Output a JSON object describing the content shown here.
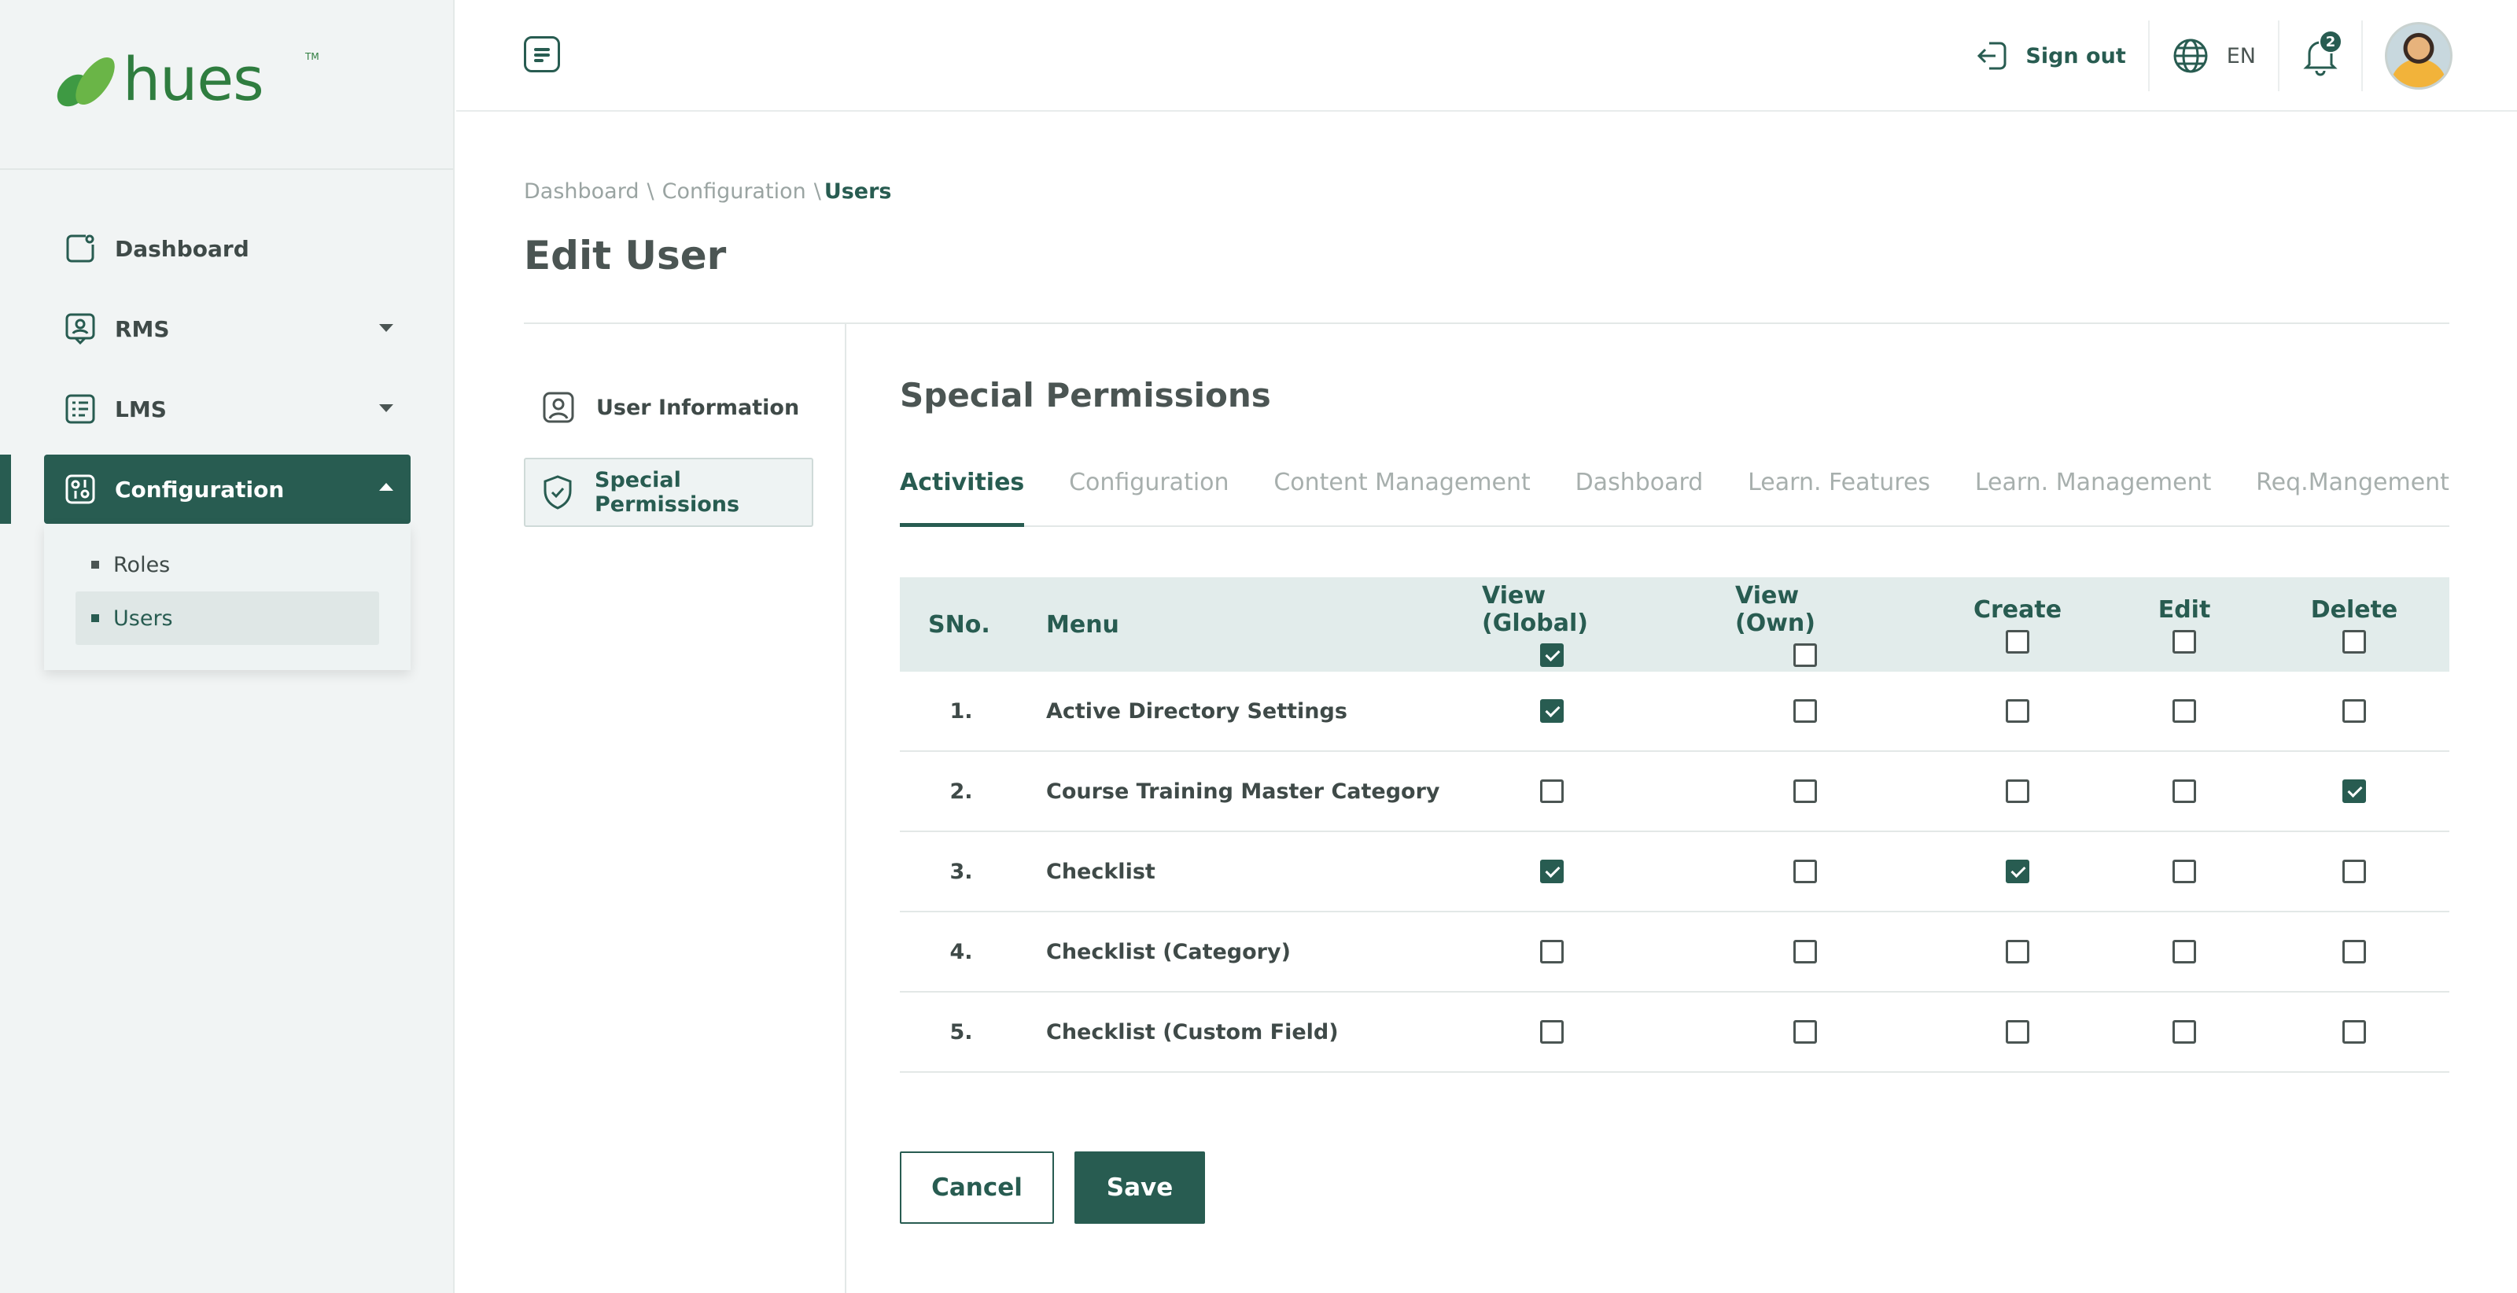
{
  "brand": {
    "name": "hues",
    "tm": "TM"
  },
  "colors": {
    "primary": "#285c51",
    "brand_green": "#2f7d3f",
    "sidebar_bg": "#f1f4f4",
    "table_head_bg": "#e2eceb"
  },
  "sidebar": {
    "items": [
      {
        "label": "Dashboard",
        "icon": "dashboard-icon",
        "expandable": false
      },
      {
        "label": "RMS",
        "icon": "rms-icon",
        "expandable": true
      },
      {
        "label": "LMS",
        "icon": "lms-icon",
        "expandable": true
      },
      {
        "label": "Configuration",
        "icon": "configuration-icon",
        "expandable": true,
        "active": true
      }
    ],
    "subitems": [
      {
        "label": "Roles",
        "active": false
      },
      {
        "label": "Users",
        "active": true
      }
    ]
  },
  "header": {
    "menu_icon": "menu-toggle-icon",
    "signout_label": "Sign out",
    "language": "EN",
    "notification_count": "2"
  },
  "breadcrumb": {
    "items": [
      "Dashboard",
      "Configuration"
    ],
    "separator": "\\",
    "current": "Users"
  },
  "page": {
    "title": "Edit User",
    "section_title": "Special Permissions"
  },
  "side_tabs": [
    {
      "label": "User Information",
      "icon": "user-icon",
      "active": false
    },
    {
      "label": "Special Permissions",
      "icon": "shield-check-icon",
      "active": true
    }
  ],
  "tabs": [
    {
      "label": "Activities",
      "active": true
    },
    {
      "label": "Configuration",
      "active": false
    },
    {
      "label": "Content Management",
      "active": false
    },
    {
      "label": "Dashboard",
      "active": false
    },
    {
      "label": "Learn. Features",
      "active": false
    },
    {
      "label": "Learn. Management",
      "active": false
    },
    {
      "label": "Req.Mangement",
      "active": false
    }
  ],
  "table": {
    "headers": {
      "sno": "SNo.",
      "menu": "Menu",
      "view_global": "View (Global)",
      "view_own": "View (Own)",
      "create": "Create",
      "edit": "Edit",
      "delete": "Delete"
    },
    "header_checks": {
      "view_global": true,
      "view_own": false,
      "create": false,
      "edit": false,
      "delete": false
    },
    "rows": [
      {
        "sno": "1.",
        "menu": "Active Directory Settings",
        "view_global": true,
        "view_own": false,
        "create": false,
        "edit": false,
        "delete": false
      },
      {
        "sno": "2.",
        "menu": "Course Training Master Category",
        "view_global": false,
        "view_own": false,
        "create": false,
        "edit": false,
        "delete": true
      },
      {
        "sno": "3.",
        "menu": "Checklist",
        "view_global": true,
        "view_own": false,
        "create": true,
        "edit": false,
        "delete": false
      },
      {
        "sno": "4.",
        "menu": "Checklist (Category)",
        "view_global": false,
        "view_own": false,
        "create": false,
        "edit": false,
        "delete": false
      },
      {
        "sno": "5.",
        "menu": "Checklist (Custom Field)",
        "view_global": false,
        "view_own": false,
        "create": false,
        "edit": false,
        "delete": false
      }
    ]
  },
  "actions": {
    "cancel_label": "Cancel",
    "save_label": "Save"
  }
}
